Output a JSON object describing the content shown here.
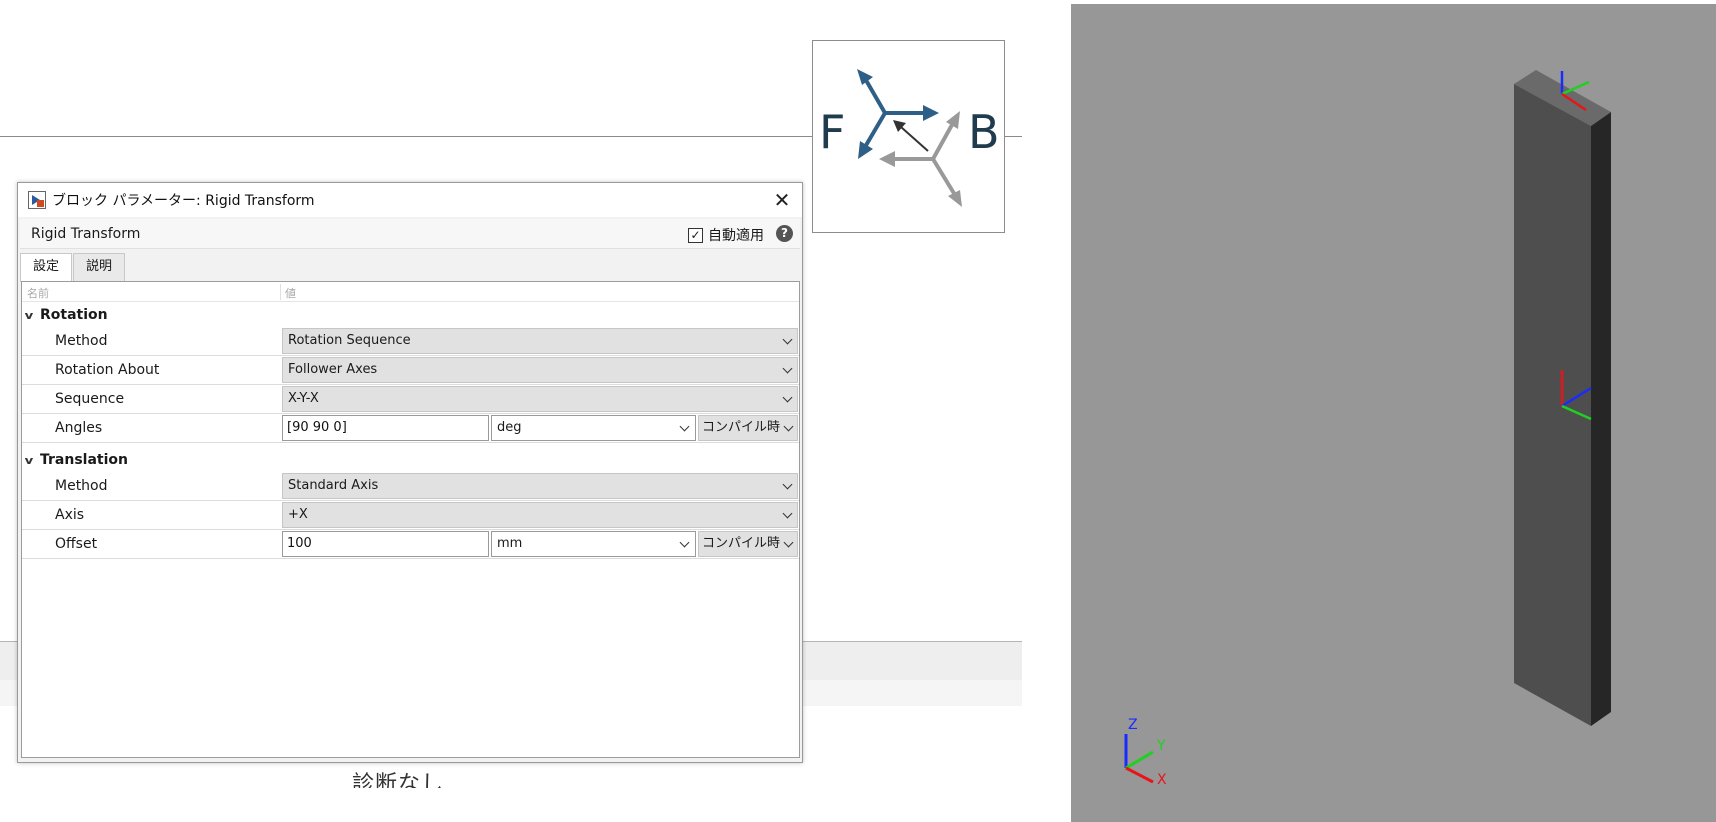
{
  "canvas": {
    "block": {
      "left_port": "F",
      "right_port": "B"
    },
    "status_text": "診断なし"
  },
  "dialog": {
    "title": "ブロック パラメーター: Rigid Transform",
    "close_glyph": "✕",
    "block_name": "Rigid Transform",
    "auto_apply_label": "自動適用",
    "auto_apply_checked": true,
    "help_glyph": "?",
    "tabs": [
      {
        "label": "設定",
        "active": true
      },
      {
        "label": "説明",
        "active": false
      }
    ],
    "columns": {
      "name": "名前",
      "value": "値"
    },
    "rotation": {
      "section_label": "Rotation",
      "method": {
        "label": "Method",
        "value": "Rotation Sequence"
      },
      "rotation_about": {
        "label": "Rotation About",
        "value": "Follower Axes"
      },
      "sequence": {
        "label": "Sequence",
        "value": "X-Y-X"
      },
      "angles": {
        "label": "Angles",
        "value": "[90 90 0]",
        "unit": "deg",
        "evaluation": "コンパイル時"
      }
    },
    "translation": {
      "section_label": "Translation",
      "method": {
        "label": "Method",
        "value": "Standard Axis"
      },
      "axis": {
        "label": "Axis",
        "value": "+X"
      },
      "offset": {
        "label": "Offset",
        "value": "100",
        "unit": "mm",
        "evaluation": "コンパイル時"
      }
    }
  },
  "viewer": {
    "triad_labels": {
      "x": "X",
      "y": "Y",
      "z": "Z"
    },
    "colors": {
      "background": "#979797",
      "x_axis": "#e8141a",
      "y_axis": "#1fd11f",
      "z_axis": "#1a2bff"
    }
  }
}
